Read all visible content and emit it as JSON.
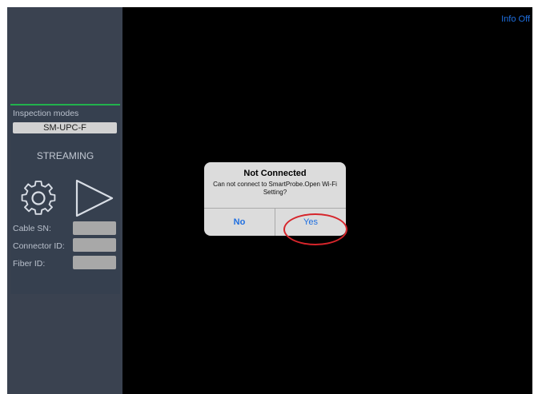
{
  "sidebar": {
    "inspection_modes_label": "Inspection modes",
    "mode_value": "SM-UPC-F",
    "streaming_label": "STREAMING",
    "settings_icon": "gear-icon",
    "start_icon": "play-icon",
    "fields": [
      {
        "label": "Cable SN:",
        "value": ""
      },
      {
        "label": "Connector ID:",
        "value": ""
      },
      {
        "label": "Fiber ID:",
        "value": ""
      }
    ]
  },
  "topbar": {
    "info_toggle": "Info Off"
  },
  "dialog": {
    "title": "Not Connected",
    "message": "Can not connect to SmartProbe.Open Wi-Fi Setting?",
    "no_label": "No",
    "yes_label": "Yes"
  },
  "annotation": {
    "highlight_color": "#d6252b"
  },
  "colors": {
    "accent": "#1f6fe0",
    "status_bar": "#22b24c",
    "sidebar_bg": "#3a4250"
  }
}
